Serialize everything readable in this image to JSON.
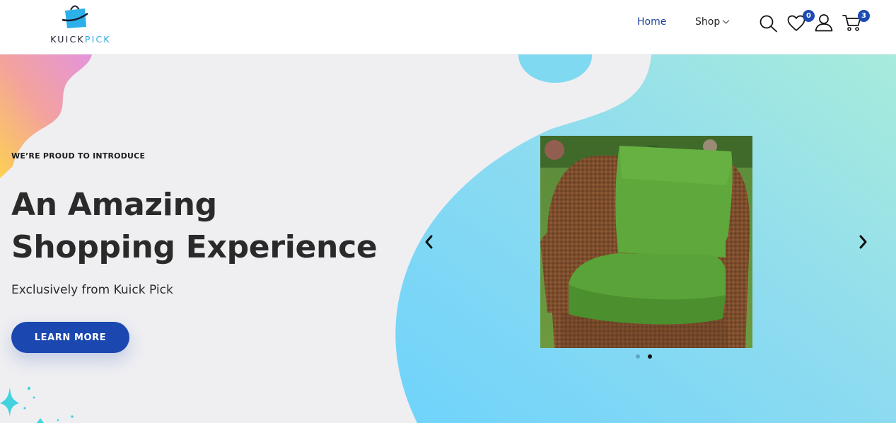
{
  "header": {
    "logo": {
      "text_part1": "KUICK",
      "text_part2": "PICK"
    },
    "nav": {
      "home": "Home",
      "shop": "Shop"
    },
    "wishlist_count": "0",
    "cart_count": "3"
  },
  "hero": {
    "eyebrow": "WE’RE PROUD TO INTRODUCE",
    "headline_line1": "An Amazing",
    "headline_line2": "Shopping Experience",
    "subtext": "Exclusively from Kuick Pick",
    "cta_label": "LEARN MORE",
    "slide_count": 2,
    "active_slide": 2
  },
  "colors": {
    "accent": "#1a47b0",
    "nav_active": "#1d3f9e",
    "badge": "#1d4bb3",
    "hero_bg": "#efeff2",
    "blob_cyan": "#7dd6f6",
    "blob_mint": "#a6e9dc",
    "logo_blue": "#29a9e1"
  },
  "icons": {
    "search": "search-icon",
    "wishlist": "heart-icon",
    "account": "user-icon",
    "cart": "cart-icon",
    "prev": "chevron-left-icon",
    "next": "chevron-right-icon",
    "shop_dropdown": "chevron-down-icon"
  }
}
